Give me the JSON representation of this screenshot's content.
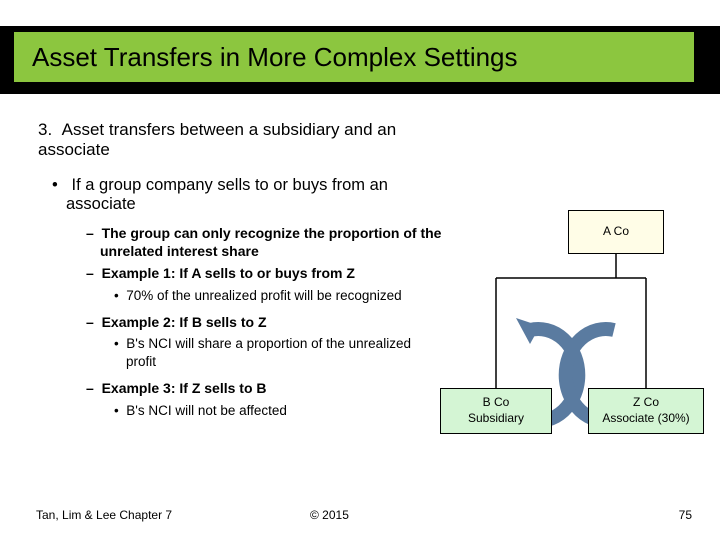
{
  "title": "Asset Transfers in More Complex Settings",
  "section": {
    "num": "3.",
    "heading": "Asset transfers between a subsidiary and an associate"
  },
  "bullet_main": "If a group company sells to or buys from an associate",
  "items": {
    "d1a": "The group can only recognize the proportion of the unrelated interest share",
    "d1b": "Example 1: If A sells to or buys from Z",
    "dot1": "70% of the unrealized profit will be recognized",
    "d2": "Example 2: If B sells to Z",
    "dot2": "B's NCI will share a proportion of the unrealized profit",
    "d3": "Example 3: If Z sells to B",
    "dot3": "B's NCI will not be affected"
  },
  "diagram": {
    "a": "A Co",
    "b1": "B Co",
    "b2": "Subsidiary",
    "z1": "Z Co",
    "z2": "Associate (30%)"
  },
  "footer": {
    "left": "Tan, Lim & Lee Chapter 7",
    "center": "© 2015",
    "right": "75"
  }
}
